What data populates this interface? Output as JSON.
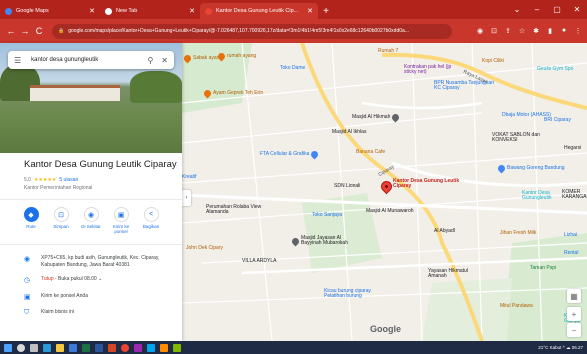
{
  "tabs": [
    {
      "title": "Google Maps",
      "active": false,
      "favicon_color": "#4285f4"
    },
    {
      "title": "New Tab",
      "active": false,
      "favicon_color": "#ffffff"
    },
    {
      "title": "Kantor Desa Gunung Leutik Cip...",
      "active": true,
      "favicon_color": "#ea4335"
    }
  ],
  "window_controls": [
    "⌄",
    "–",
    "▢",
    "✕"
  ],
  "omnibox": {
    "url": "google.com/maps/place/Kantor+Desa+Gunung+Leutik+Ciparay/@-7.026487,107.700926,17z/data=!3m1!4b1!4m5!3m4!1s0x2e68c12640b0027b0xdd0a..."
  },
  "search": {
    "query": "kantor desa gunungleutik"
  },
  "place": {
    "name": "Kantor Desa Gunung Leutik Ciparay",
    "rating": "5,0",
    "stars": "★★★★★",
    "review_count": "5 ulasan",
    "category": "Kantor Pemerintahan Regional"
  },
  "actions": [
    {
      "label": "Rute",
      "icon": "◆",
      "name": "route-button"
    },
    {
      "label": "Simpan",
      "icon": "⊡",
      "name": "save-button"
    },
    {
      "label": "Di Sekitar",
      "icon": "◉",
      "name": "nearby-button"
    },
    {
      "label": "Kirim ke ponsel",
      "icon": "▣",
      "name": "send-to-phone-button"
    },
    {
      "label": "Bagikan",
      "icon": "<",
      "name": "share-button"
    }
  ],
  "info": {
    "address": "XP75+C65, kp budi asih, Gunungleutik, Kec. Ciparay, Kabupaten Bandung, Jawa Barat 40381",
    "hours_status": "Tutup",
    "hours_detail": " · Buka pukul 08.00",
    "send_phone": "Kirim ke ponsel Anda",
    "claim": "Klaim bisnis ini"
  },
  "map": {
    "selected_label": "Kantor Desa Gunung Leutik Ciparay",
    "google_logo": "Google",
    "places": [
      {
        "name": "Sabak ayam",
        "color": "#e8710a"
      },
      {
        "name": "rumah ayang",
        "color": "#e8710a"
      },
      {
        "name": "Toko Dame",
        "color": "#4285f4"
      },
      {
        "name": "Ayam Geprek Teh Erin",
        "color": "#e8710a"
      },
      {
        "name": "Rumah 7",
        "color": "#e8710a"
      },
      {
        "name": "Kontrakan pak hel (jp sticky net)",
        "color": "#7b1fa2"
      },
      {
        "name": "Kopi Ciliki",
        "color": "#e8710a"
      },
      {
        "name": "BPR Nusamba Tanjungsari KC Ciparay",
        "color": "#4285f4"
      },
      {
        "name": "Geulis Gym Spo",
        "color": "#12b5cb"
      },
      {
        "name": "Masjid Al Hikmah",
        "color": "#5f6368"
      },
      {
        "name": "Masjid Al Ikhlas",
        "color": "#5f6368"
      },
      {
        "name": "Dbaja Motor (AHASS)",
        "color": "#4285f4"
      },
      {
        "name": "BRI Ciparay",
        "color": "#4285f4"
      },
      {
        "name": "FTA Cellular & Grafika",
        "color": "#4285f4"
      },
      {
        "name": "Banana Cafe",
        "color": "#e8710a"
      },
      {
        "name": "VOKAT SABLON dan KONVEKSI",
        "color": "#4285f4"
      },
      {
        "name": "SDN Lionali",
        "color": "#5f6368"
      },
      {
        "name": "Bawang Goreng Bandung",
        "color": "#4285f4"
      },
      {
        "name": "Kantor Desa Gunungleutik",
        "color": "#12b5cb"
      },
      {
        "name": "Masjid Al Munawaroh",
        "color": "#5f6368"
      },
      {
        "name": "Kreatif",
        "color": "#4285f4"
      },
      {
        "name": "Perumahan Rolaba View Alamanda",
        "color": "#5f6368"
      },
      {
        "name": "Toko Sanjaya",
        "color": "#4285f4"
      },
      {
        "name": "Al Abyadl",
        "color": "#5f6368"
      },
      {
        "name": "Jihan Fresh Milk",
        "color": "#e8710a"
      },
      {
        "name": "John Dek Cipary",
        "color": "#e8710a"
      },
      {
        "name": "Masjid Jayasan Al Bayyinah Mubarokah",
        "color": "#5f6368"
      },
      {
        "name": "VILLA ARDYLA",
        "color": "#5f6368"
      },
      {
        "name": "Kicau burung ciparay Pelatihan burung",
        "color": "#4285f4"
      },
      {
        "name": "Yayasan Hikmatul Amanah",
        "color": "#5f6368"
      },
      {
        "name": "Taman Pspi",
        "color": "#34a853"
      },
      {
        "name": "Mitul Pandawa",
        "color": "#e8710a"
      },
      {
        "name": "Kantor Gampa",
        "color": "#12b5cb"
      },
      {
        "name": "KOMER KARANGANYAR",
        "color": "#5f6368"
      },
      {
        "name": "Lizhai",
        "color": "#4285f4"
      },
      {
        "name": "Raya Laswi",
        "color": "#5f6368"
      },
      {
        "name": "Hegarsi",
        "color": "#5f6368"
      },
      {
        "name": "Rental",
        "color": "#4285f4"
      },
      {
        "name": "Ciparay",
        "color": "#5f6368"
      }
    ]
  },
  "taskbar": {
    "tray": "21°C Kabut  ^  ☁  06.27"
  }
}
